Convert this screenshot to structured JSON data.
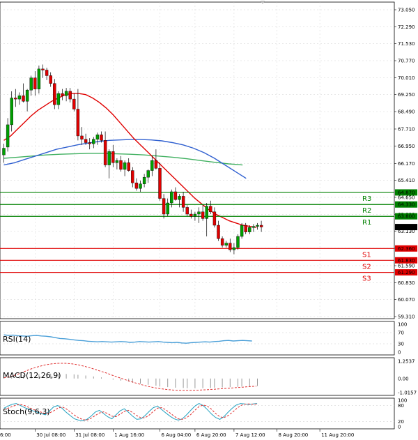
{
  "chart_data": {
    "type": "candlestick",
    "colors": {
      "bull": "#00a000",
      "bear": "#e00000",
      "ma_fast": "#e00000",
      "ma_mid": "#3060d0",
      "ma_slow": "#40b060",
      "resistance": "#008000",
      "support": "#e00000",
      "grid": "#c8c8c8",
      "rsi_line": "#4a9fd8",
      "macd_hist": "#999999",
      "macd_signal": "#e03030",
      "stoch_main": "#20a0c0",
      "stoch_signal": "#e03030"
    },
    "price_axis": {
      "ticks": [
        "73.050",
        "72.290",
        "71.530",
        "70.770",
        "70.010",
        "69.250",
        "68.490",
        "67.710",
        "66.950",
        "66.170",
        "65.410",
        "64.650",
        "63.890",
        "63.130",
        "62.370",
        "61.590",
        "60.830",
        "60.070",
        "59.310"
      ],
      "ylim": [
        59.31,
        73.05
      ]
    },
    "time_axis": {
      "labels": [
        "30 Jul 08:00",
        "31 Jul 08:00",
        "1 Aug 16:00",
        "6 Aug 04:00",
        "6 Aug 20:00",
        "7 Aug 12:00",
        "8 Aug 20:00",
        "11 Aug 20:00"
      ],
      "label_indices": [
        8,
        18,
        28,
        40,
        49,
        59,
        70,
        81
      ],
      "edge_label": "6:00"
    },
    "candles": [
      {
        "o": 66.55,
        "h": 67.05,
        "l": 66.2,
        "c": 66.85
      },
      {
        "o": 66.9,
        "h": 68.2,
        "l": 66.7,
        "c": 67.9
      },
      {
        "o": 67.9,
        "h": 69.4,
        "l": 67.6,
        "c": 69.1
      },
      {
        "o": 69.1,
        "h": 69.5,
        "l": 68.7,
        "c": 69.05
      },
      {
        "o": 69.05,
        "h": 69.35,
        "l": 68.8,
        "c": 69.2
      },
      {
        "o": 69.2,
        "h": 69.75,
        "l": 68.9,
        "c": 68.95
      },
      {
        "o": 68.95,
        "h": 69.5,
        "l": 68.5,
        "c": 69.45
      },
      {
        "o": 69.45,
        "h": 70.1,
        "l": 69.2,
        "c": 70.0
      },
      {
        "o": 70.0,
        "h": 70.3,
        "l": 69.2,
        "c": 69.5
      },
      {
        "o": 69.5,
        "h": 70.55,
        "l": 69.3,
        "c": 70.4
      },
      {
        "o": 70.4,
        "h": 70.6,
        "l": 70.0,
        "c": 70.35
      },
      {
        "o": 70.35,
        "h": 70.45,
        "l": 69.9,
        "c": 70.1
      },
      {
        "o": 70.1,
        "h": 70.25,
        "l": 69.6,
        "c": 69.75
      },
      {
        "o": 69.75,
        "h": 69.95,
        "l": 68.6,
        "c": 68.8
      },
      {
        "o": 68.8,
        "h": 69.4,
        "l": 68.6,
        "c": 69.3
      },
      {
        "o": 69.3,
        "h": 69.5,
        "l": 69.0,
        "c": 69.2
      },
      {
        "o": 69.2,
        "h": 69.55,
        "l": 68.95,
        "c": 69.4
      },
      {
        "o": 69.4,
        "h": 69.55,
        "l": 68.9,
        "c": 69.05
      },
      {
        "o": 69.05,
        "h": 69.3,
        "l": 68.5,
        "c": 68.6
      },
      {
        "o": 68.6,
        "h": 69.5,
        "l": 67.2,
        "c": 67.4
      },
      {
        "o": 67.4,
        "h": 67.8,
        "l": 67.0,
        "c": 67.25
      },
      {
        "o": 67.25,
        "h": 67.5,
        "l": 67.0,
        "c": 67.1
      },
      {
        "o": 67.1,
        "h": 67.3,
        "l": 66.8,
        "c": 67.05
      },
      {
        "o": 67.05,
        "h": 67.35,
        "l": 66.85,
        "c": 67.25
      },
      {
        "o": 67.25,
        "h": 67.55,
        "l": 67.0,
        "c": 67.45
      },
      {
        "o": 67.45,
        "h": 67.6,
        "l": 67.1,
        "c": 67.2
      },
      {
        "o": 67.2,
        "h": 67.6,
        "l": 66.0,
        "c": 66.1
      },
      {
        "o": 66.1,
        "h": 66.8,
        "l": 65.5,
        "c": 66.7
      },
      {
        "o": 66.7,
        "h": 67.0,
        "l": 66.0,
        "c": 66.2
      },
      {
        "o": 66.2,
        "h": 66.4,
        "l": 65.9,
        "c": 66.3
      },
      {
        "o": 66.3,
        "h": 66.5,
        "l": 65.8,
        "c": 65.9
      },
      {
        "o": 65.9,
        "h": 66.3,
        "l": 65.6,
        "c": 66.2
      },
      {
        "o": 66.2,
        "h": 66.4,
        "l": 65.8,
        "c": 65.85
      },
      {
        "o": 65.85,
        "h": 66.0,
        "l": 65.1,
        "c": 65.3
      },
      {
        "o": 65.3,
        "h": 65.5,
        "l": 64.95,
        "c": 65.05
      },
      {
        "o": 65.05,
        "h": 65.4,
        "l": 64.9,
        "c": 65.25
      },
      {
        "o": 65.25,
        "h": 65.7,
        "l": 65.1,
        "c": 65.55
      },
      {
        "o": 65.55,
        "h": 65.9,
        "l": 65.3,
        "c": 65.85
      },
      {
        "o": 65.85,
        "h": 66.5,
        "l": 65.6,
        "c": 66.3
      },
      {
        "o": 66.3,
        "h": 66.8,
        "l": 65.9,
        "c": 65.95
      },
      {
        "o": 65.95,
        "h": 66.2,
        "l": 64.5,
        "c": 64.6
      },
      {
        "o": 64.6,
        "h": 64.8,
        "l": 63.7,
        "c": 63.9
      },
      {
        "o": 63.9,
        "h": 64.6,
        "l": 63.8,
        "c": 64.4
      },
      {
        "o": 64.4,
        "h": 65.0,
        "l": 64.2,
        "c": 64.9
      },
      {
        "o": 64.9,
        "h": 65.1,
        "l": 64.5,
        "c": 64.55
      },
      {
        "o": 64.55,
        "h": 64.8,
        "l": 64.2,
        "c": 64.7
      },
      {
        "o": 64.7,
        "h": 64.9,
        "l": 64.0,
        "c": 64.2
      },
      {
        "o": 64.2,
        "h": 64.3,
        "l": 63.8,
        "c": 63.9
      },
      {
        "o": 63.9,
        "h": 64.1,
        "l": 63.7,
        "c": 63.8
      },
      {
        "o": 63.8,
        "h": 64.0,
        "l": 63.6,
        "c": 63.9
      },
      {
        "o": 63.9,
        "h": 64.2,
        "l": 63.5,
        "c": 64.0
      },
      {
        "o": 64.0,
        "h": 64.3,
        "l": 63.6,
        "c": 63.7
      },
      {
        "o": 63.7,
        "h": 64.4,
        "l": 62.9,
        "c": 64.25
      },
      {
        "o": 64.25,
        "h": 64.5,
        "l": 63.9,
        "c": 64.0
      },
      {
        "o": 64.0,
        "h": 64.2,
        "l": 63.3,
        "c": 63.4
      },
      {
        "o": 63.4,
        "h": 63.6,
        "l": 62.7,
        "c": 62.8
      },
      {
        "o": 62.8,
        "h": 62.9,
        "l": 62.4,
        "c": 62.5
      },
      {
        "o": 62.5,
        "h": 62.7,
        "l": 62.4,
        "c": 62.6
      },
      {
        "o": 62.6,
        "h": 62.8,
        "l": 62.2,
        "c": 62.3
      },
      {
        "o": 62.3,
        "h": 62.6,
        "l": 62.1,
        "c": 62.4
      },
      {
        "o": 62.4,
        "h": 63.0,
        "l": 62.3,
        "c": 62.9
      },
      {
        "o": 62.9,
        "h": 63.5,
        "l": 62.8,
        "c": 63.4
      },
      {
        "o": 63.4,
        "h": 63.5,
        "l": 63.0,
        "c": 63.1
      },
      {
        "o": 63.1,
        "h": 63.4,
        "l": 63.0,
        "c": 63.3
      },
      {
        "o": 63.3,
        "h": 63.45,
        "l": 63.1,
        "c": 63.35
      },
      {
        "o": 63.35,
        "h": 63.5,
        "l": 63.2,
        "c": 63.4
      },
      {
        "o": 63.4,
        "h": 63.6,
        "l": 63.1,
        "c": 63.32
      }
    ],
    "moving_averages": {
      "fast": [
        67.2,
        67.4,
        67.7,
        68.0,
        68.3,
        68.55,
        68.75,
        68.95,
        69.1,
        69.25,
        69.3,
        69.3,
        69.25,
        69.1,
        68.9,
        68.65,
        68.35,
        68.0,
        67.65,
        67.3,
        67.0,
        66.7,
        66.4,
        66.1,
        65.8,
        65.5,
        65.2,
        64.9,
        64.6,
        64.35,
        64.1,
        63.9,
        63.75,
        63.6,
        63.5,
        63.4,
        63.35,
        63.3
      ],
      "mid": [
        66.1,
        66.2,
        66.35,
        66.5,
        66.65,
        66.8,
        66.9,
        67.0,
        67.08,
        67.15,
        67.2,
        67.22,
        67.24,
        67.24,
        67.22,
        67.18,
        67.1,
        67.0,
        66.85,
        66.65,
        66.4,
        66.1,
        65.8,
        65.5
      ],
      "slow": [
        66.4,
        66.45,
        66.5,
        66.55,
        66.58,
        66.6,
        66.62,
        66.62,
        66.6,
        66.58,
        66.55,
        66.5,
        66.45,
        66.38,
        66.3,
        66.22,
        66.15,
        66.1
      ]
    },
    "levels": [
      {
        "name": "R3",
        "value": 64.87,
        "kind": "resistance"
      },
      {
        "name": "R2",
        "value": 64.33,
        "kind": "resistance"
      },
      {
        "name": "R1",
        "value": 63.8,
        "kind": "resistance"
      },
      {
        "name": "S1",
        "value": 62.36,
        "kind": "support"
      },
      {
        "name": "S2",
        "value": 61.83,
        "kind": "support"
      },
      {
        "name": "S3",
        "value": 61.29,
        "kind": "support"
      }
    ],
    "current_price": "63.320",
    "indicators": {
      "rsi": {
        "label": "RSI(14)",
        "ticks": [
          "100",
          "70",
          "30",
          "0"
        ],
        "values": [
          62,
          60,
          61,
          59,
          58,
          57,
          59,
          60,
          58,
          57,
          55,
          52,
          49,
          48,
          46,
          44,
          42,
          41,
          39,
          38,
          37,
          38,
          37,
          36,
          37,
          38,
          37,
          35,
          36,
          38,
          37,
          36,
          37,
          38,
          36,
          35,
          34,
          35,
          33,
          32,
          34,
          35,
          36,
          37,
          36,
          38,
          39,
          41,
          42,
          40,
          41,
          42,
          41,
          40
        ]
      },
      "macd": {
        "label": "MACD(12,26,9)",
        "ticks": [
          "1.2537",
          "0.00",
          "-1.0157"
        ],
        "hist": [
          0.1,
          0.15,
          0.2,
          0.25,
          0.3,
          0.32,
          0.34,
          0.35,
          0.34,
          0.33,
          0.3,
          0.27,
          0.22,
          0.15,
          0.08,
          0.0,
          -0.08,
          -0.15,
          -0.22,
          -0.3,
          -0.38,
          -0.45,
          -0.52,
          -0.58,
          -0.62,
          -0.66,
          -0.68,
          -0.7,
          -0.7,
          -0.69,
          -0.68,
          -0.66,
          -0.64,
          -0.62,
          -0.6,
          -0.58,
          -0.56,
          -0.54
        ],
        "signal": [
          0.05,
          0.15,
          0.3,
          0.5,
          0.7,
          0.85,
          0.98,
          1.06,
          1.1,
          1.1,
          1.06,
          0.98,
          0.86,
          0.72,
          0.56,
          0.4,
          0.22,
          0.05,
          -0.12,
          -0.28,
          -0.42,
          -0.55,
          -0.66,
          -0.74,
          -0.8,
          -0.84,
          -0.86,
          -0.86,
          -0.85,
          -0.83,
          -0.8,
          -0.77,
          -0.73,
          -0.7,
          -0.66,
          -0.62,
          -0.58,
          -0.55
        ]
      },
      "stoch": {
        "label": "Stoch(9,6,3)",
        "ticks": [
          "100",
          "80",
          "20",
          "0"
        ],
        "main": [
          70,
          78,
          85,
          88,
          80,
          72,
          66,
          60,
          55,
          50,
          45,
          60,
          75,
          80,
          70,
          55,
          42,
          30,
          25,
          22,
          28,
          40,
          55,
          62,
          50,
          38,
          30,
          45,
          60,
          68,
          55,
          40,
          28,
          30,
          42,
          58,
          72,
          78,
          65,
          52,
          40,
          30,
          25,
          30,
          45,
          62,
          78,
          88,
          80,
          65,
          48,
          35,
          28,
          38,
          55,
          70,
          82,
          88,
          86,
          84,
          86,
          88
        ],
        "signal": [
          65,
          70,
          76,
          82,
          84,
          80,
          73,
          66,
          60,
          55,
          50,
          52,
          60,
          70,
          75,
          68,
          56,
          44,
          34,
          27,
          25,
          32,
          42,
          52,
          56,
          50,
          40,
          38,
          48,
          58,
          62,
          54,
          42,
          34,
          34,
          44,
          58,
          70,
          72,
          64,
          52,
          40,
          30,
          28,
          34,
          46,
          62,
          76,
          82,
          78,
          66,
          50,
          38,
          34,
          42,
          54,
          68,
          80,
          85,
          86,
          85,
          86
        ]
      }
    }
  }
}
